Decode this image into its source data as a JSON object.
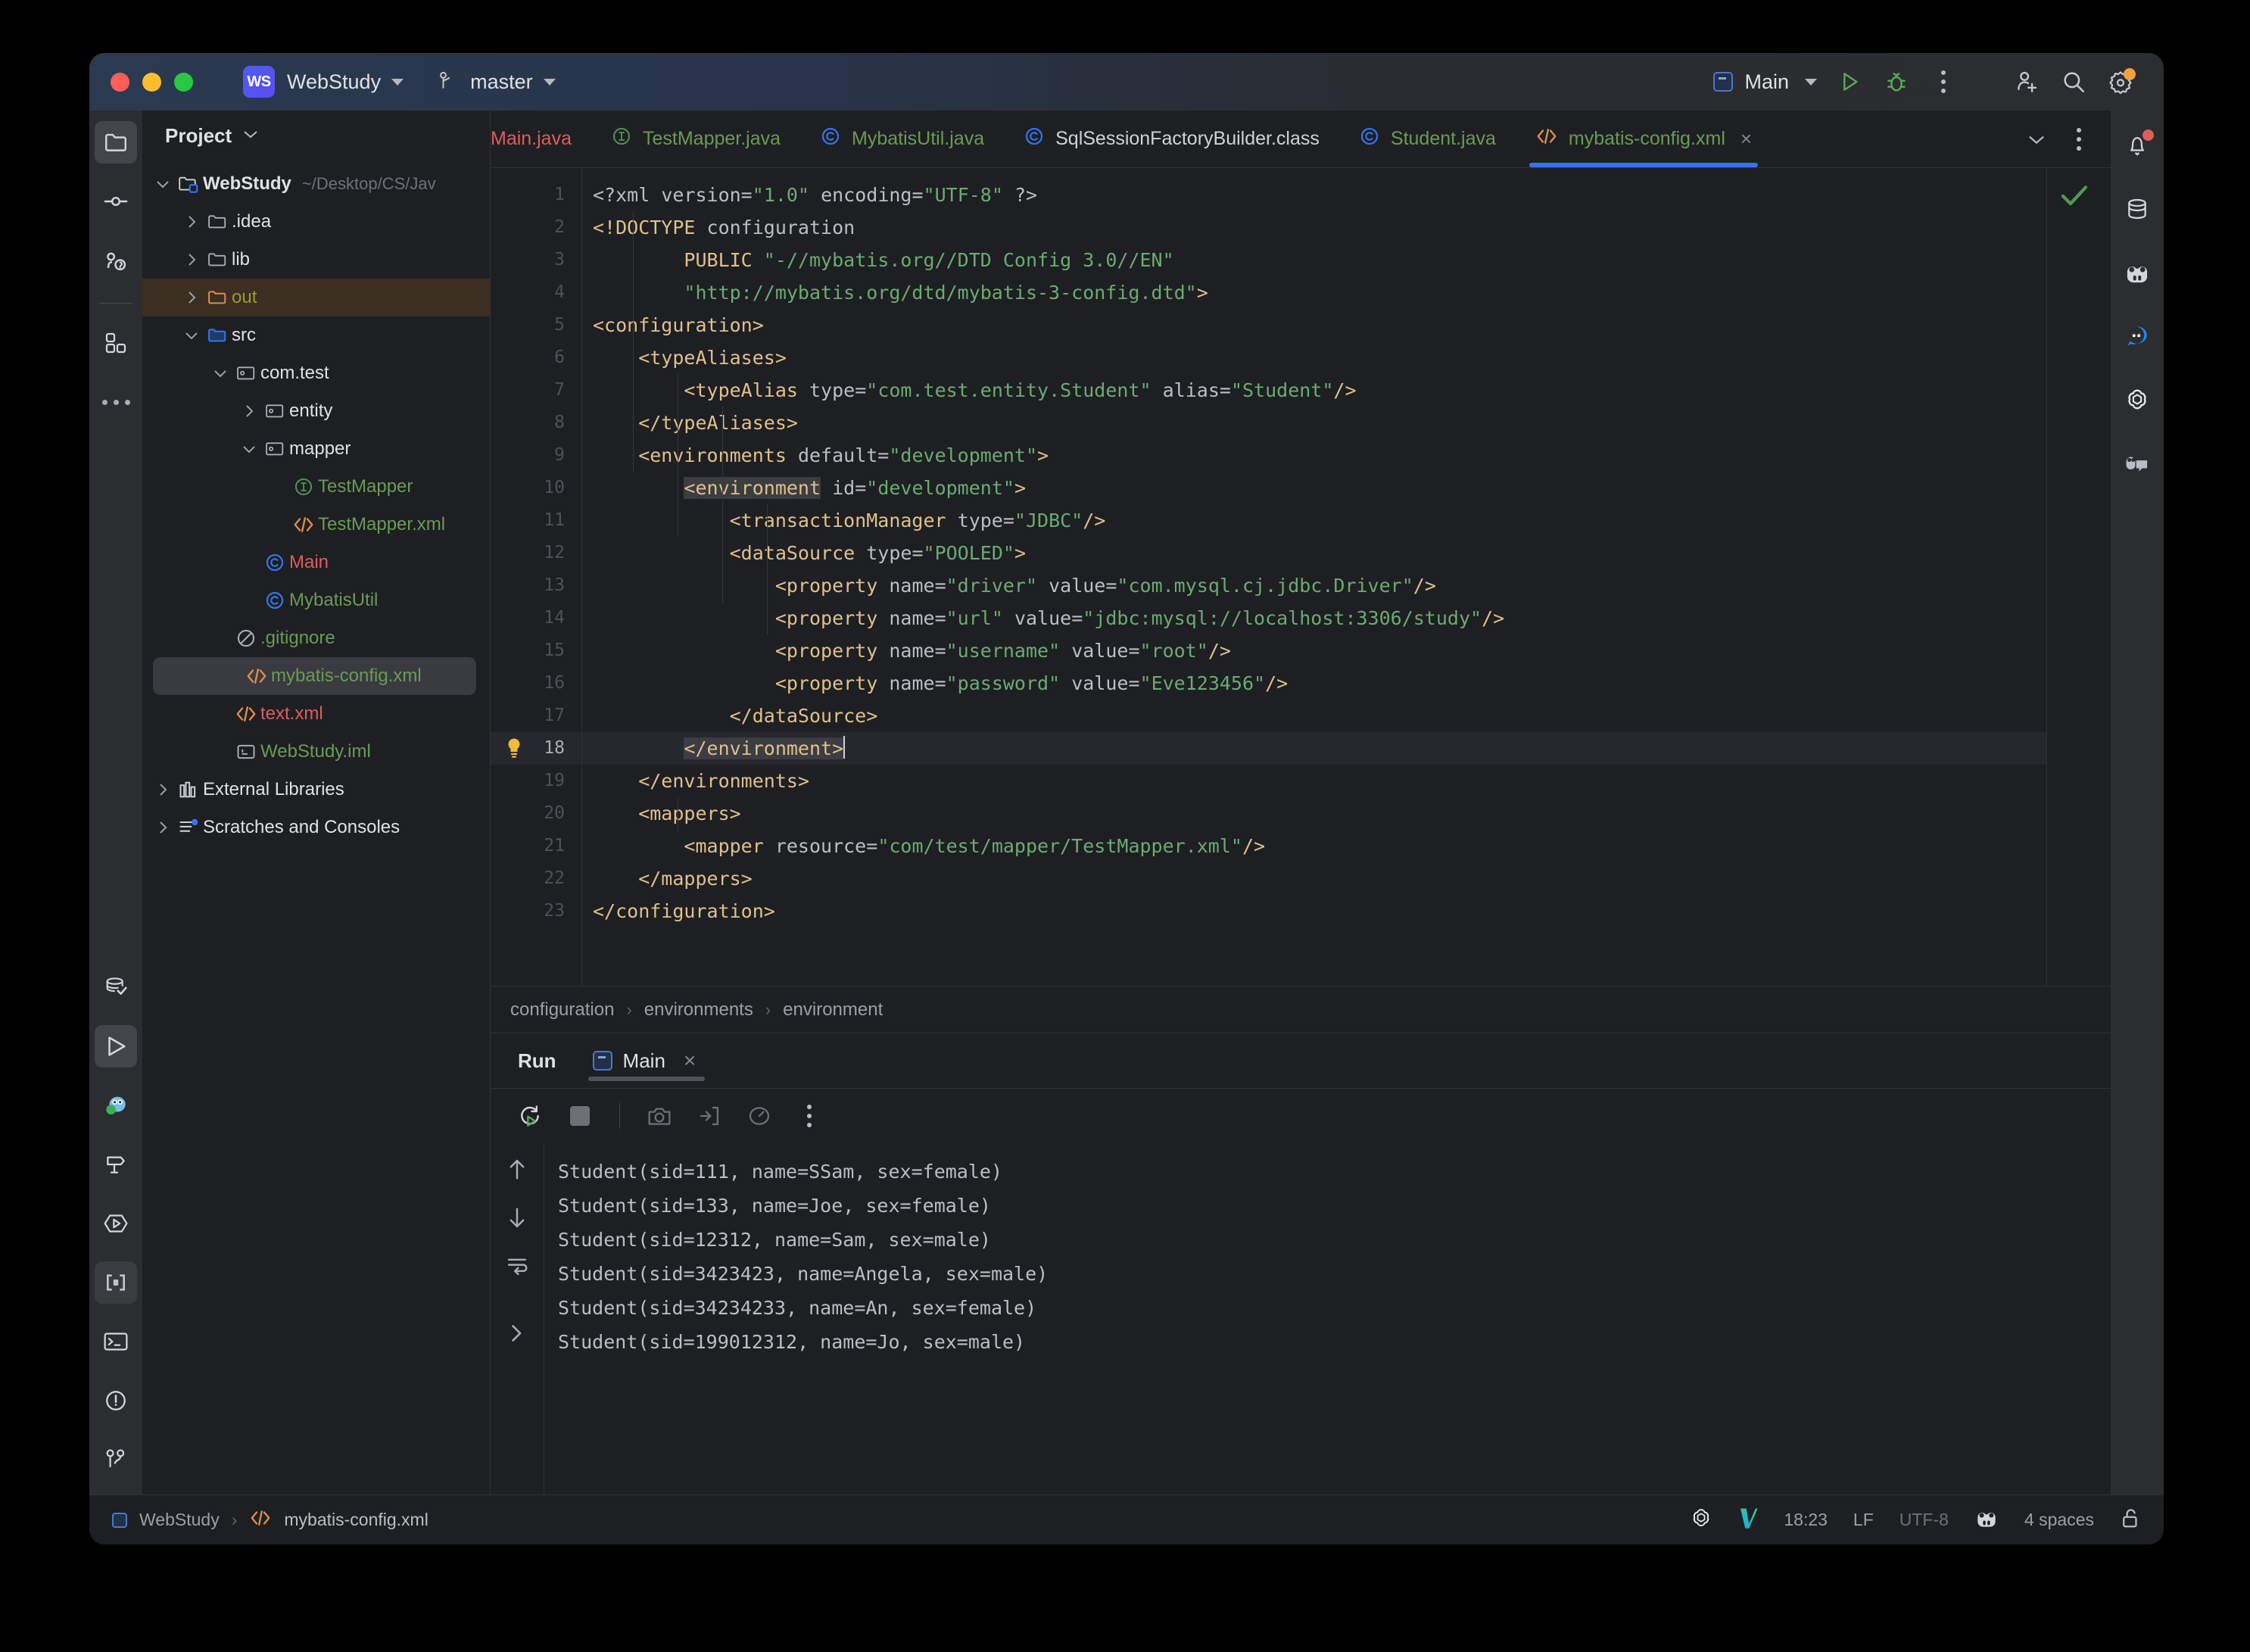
{
  "titlebar": {
    "project_badge": "WS",
    "project_name": "WebStudy",
    "branch": "master",
    "run_config": "Main",
    "icons": [
      "run-icon",
      "debug-icon",
      "more-actions-icon",
      "add-collaborator-icon",
      "search-everywhere-icon",
      "settings-icon"
    ]
  },
  "project_panel": {
    "title": "Project",
    "tree": [
      {
        "label": "WebStudy",
        "path": "~/Desktop/CS/Jav",
        "icon": "module-folder-icon",
        "arrow": "down",
        "indent": 0,
        "style": "bold",
        "state": "normal"
      },
      {
        "label": ".idea",
        "path": "",
        "icon": "folder-icon",
        "arrow": "right",
        "indent": 1,
        "style": "plain",
        "state": "normal"
      },
      {
        "label": "lib",
        "path": "",
        "icon": "folder-icon",
        "arrow": "right",
        "indent": 1,
        "style": "plain",
        "state": "normal"
      },
      {
        "label": "out",
        "path": "",
        "icon": "excluded-folder-icon",
        "arrow": "right",
        "indent": 1,
        "style": "olive",
        "state": "out"
      },
      {
        "label": "src",
        "path": "",
        "icon": "source-folder-icon",
        "arrow": "down",
        "indent": 1,
        "style": "plain",
        "state": "normal"
      },
      {
        "label": "com.test",
        "path": "",
        "icon": "package-icon",
        "arrow": "down",
        "indent": 2,
        "style": "plain",
        "state": "normal"
      },
      {
        "label": "entity",
        "path": "",
        "icon": "package-icon",
        "arrow": "right",
        "indent": 3,
        "style": "plain",
        "state": "normal"
      },
      {
        "label": "mapper",
        "path": "",
        "icon": "package-icon",
        "arrow": "down",
        "indent": 3,
        "style": "plain",
        "state": "normal"
      },
      {
        "label": "TestMapper",
        "path": "",
        "icon": "interface-icon",
        "arrow": "none",
        "indent": 4,
        "style": "green",
        "state": "normal"
      },
      {
        "label": "TestMapper.xml",
        "path": "",
        "icon": "xml-icon",
        "arrow": "none",
        "indent": 4,
        "style": "green",
        "state": "normal"
      },
      {
        "label": "Main",
        "path": "",
        "icon": "class-icon",
        "arrow": "none",
        "indent": 3,
        "style": "red",
        "state": "normal"
      },
      {
        "label": "MybatisUtil",
        "path": "",
        "icon": "class-icon",
        "arrow": "none",
        "indent": 3,
        "style": "green",
        "state": "normal"
      },
      {
        "label": ".gitignore",
        "path": "",
        "icon": "gitignore-icon",
        "arrow": "none",
        "indent": 2,
        "style": "green",
        "state": "normal"
      },
      {
        "label": "mybatis-config.xml",
        "path": "",
        "icon": "xml-icon",
        "arrow": "none",
        "indent": 2,
        "style": "green",
        "state": "selected"
      },
      {
        "label": "text.xml",
        "path": "",
        "icon": "xml-icon",
        "arrow": "none",
        "indent": 2,
        "style": "red",
        "state": "normal"
      },
      {
        "label": "WebStudy.iml",
        "path": "",
        "icon": "iml-icon",
        "arrow": "none",
        "indent": 2,
        "style": "green",
        "state": "normal"
      },
      {
        "label": "External Libraries",
        "path": "",
        "icon": "library-icon",
        "arrow": "right",
        "indent": 0,
        "style": "plain",
        "state": "normal"
      },
      {
        "label": "Scratches and Consoles",
        "path": "",
        "icon": "scratches-icon",
        "arrow": "right",
        "indent": 0,
        "style": "plain",
        "state": "normal"
      }
    ]
  },
  "editor": {
    "tabs": [
      {
        "label": "Main.java",
        "icon": "class-icon",
        "color": "red",
        "active": false,
        "clipped": true
      },
      {
        "label": "TestMapper.java",
        "icon": "interface-icon",
        "color": "green",
        "active": false,
        "clipped": false
      },
      {
        "label": "MybatisUtil.java",
        "icon": "class-icon",
        "color": "green",
        "active": false,
        "clipped": false
      },
      {
        "label": "SqlSessionFactoryBuilder.class",
        "icon": "class-icon",
        "color": "white",
        "active": false,
        "clipped": false
      },
      {
        "label": "Student.java",
        "icon": "class-icon",
        "color": "green",
        "active": false,
        "clipped": false
      },
      {
        "label": "mybatis-config.xml",
        "icon": "xml-icon",
        "color": "green",
        "active": true,
        "clipped": false
      }
    ],
    "tab_close": "×",
    "filename": "mybatis-config.xml",
    "inspection_status": "no-problems-check-icon",
    "current_line": 18,
    "line_count": 23,
    "lines": [
      {
        "n": 1,
        "segments": [
          [
            "plain",
            "<?xml "
          ],
          [
            "attr",
            "version"
          ],
          [
            "plain",
            "="
          ],
          [
            "str",
            "\"1.0\""
          ],
          [
            "plain",
            " "
          ],
          [
            "attr",
            "encoding"
          ],
          [
            "plain",
            "="
          ],
          [
            "str",
            "\"UTF-8\""
          ],
          [
            "plain",
            " ?>"
          ]
        ]
      },
      {
        "n": 2,
        "segments": [
          [
            "doct",
            "<!DOCTYPE"
          ],
          [
            "attr",
            " configuration"
          ]
        ]
      },
      {
        "n": 3,
        "segments": [
          [
            "doct",
            "        PUBLIC "
          ],
          [
            "str",
            "\"-//mybatis.org//DTD Config 3.0//EN\""
          ]
        ]
      },
      {
        "n": 4,
        "segments": [
          [
            "str",
            "        \"http://mybatis.org/dtd/mybatis-3-config.dtd\""
          ],
          [
            "doct",
            ">"
          ]
        ]
      },
      {
        "n": 5,
        "segments": [
          [
            "tag",
            "<configuration>"
          ]
        ]
      },
      {
        "n": 6,
        "segments": [
          [
            "tag",
            "    <typeAliases>"
          ]
        ]
      },
      {
        "n": 7,
        "segments": [
          [
            "tag",
            "        <typeAlias "
          ],
          [
            "attr",
            "type"
          ],
          [
            "plain",
            "="
          ],
          [
            "str",
            "\"com.test.entity.Student\""
          ],
          [
            "attr",
            " alias"
          ],
          [
            "plain",
            "="
          ],
          [
            "str",
            "\"Student\""
          ],
          [
            "tag",
            "/>"
          ]
        ]
      },
      {
        "n": 8,
        "segments": [
          [
            "tag",
            "    </typeAliases>"
          ]
        ]
      },
      {
        "n": 9,
        "segments": [
          [
            "tag",
            "    <environments "
          ],
          [
            "attr",
            "default"
          ],
          [
            "plain",
            "="
          ],
          [
            "str",
            "\"development\""
          ],
          [
            "tag",
            ">"
          ]
        ]
      },
      {
        "n": 10,
        "segments": [
          [
            "tag",
            "        "
          ],
          [
            "hlt",
            "<environment"
          ],
          [
            "attr",
            " id"
          ],
          [
            "plain",
            "="
          ],
          [
            "str",
            "\"development\""
          ],
          [
            "tag",
            ">"
          ]
        ]
      },
      {
        "n": 11,
        "segments": [
          [
            "tag",
            "            <transactionManager "
          ],
          [
            "attr",
            "type"
          ],
          [
            "plain",
            "="
          ],
          [
            "str",
            "\"JDBC\""
          ],
          [
            "tag",
            "/>"
          ]
        ]
      },
      {
        "n": 12,
        "segments": [
          [
            "tag",
            "            <dataSource "
          ],
          [
            "attr",
            "type"
          ],
          [
            "plain",
            "="
          ],
          [
            "str",
            "\"POOLED\""
          ],
          [
            "tag",
            ">"
          ]
        ]
      },
      {
        "n": 13,
        "segments": [
          [
            "tag",
            "                <property "
          ],
          [
            "attr",
            "name"
          ],
          [
            "plain",
            "="
          ],
          [
            "str",
            "\"driver\""
          ],
          [
            "attr",
            " value"
          ],
          [
            "plain",
            "="
          ],
          [
            "str",
            "\"com.mysql.cj.jdbc.Driver\""
          ],
          [
            "tag",
            "/>"
          ]
        ]
      },
      {
        "n": 14,
        "segments": [
          [
            "tag",
            "                <property "
          ],
          [
            "attr",
            "name"
          ],
          [
            "plain",
            "="
          ],
          [
            "str",
            "\"url\""
          ],
          [
            "attr",
            " value"
          ],
          [
            "plain",
            "="
          ],
          [
            "str",
            "\"jdbc:mysql://localhost:3306/study\""
          ],
          [
            "tag",
            "/>"
          ]
        ]
      },
      {
        "n": 15,
        "segments": [
          [
            "tag",
            "                <property "
          ],
          [
            "attr",
            "name"
          ],
          [
            "plain",
            "="
          ],
          [
            "str",
            "\"username\""
          ],
          [
            "attr",
            " value"
          ],
          [
            "plain",
            "="
          ],
          [
            "str",
            "\"root\""
          ],
          [
            "tag",
            "/>"
          ]
        ]
      },
      {
        "n": 16,
        "segments": [
          [
            "tag",
            "                <property "
          ],
          [
            "attr",
            "name"
          ],
          [
            "plain",
            "="
          ],
          [
            "str",
            "\"password\""
          ],
          [
            "attr",
            " value"
          ],
          [
            "plain",
            "="
          ],
          [
            "str",
            "\"Eve123456\""
          ],
          [
            "tag",
            "/>"
          ]
        ]
      },
      {
        "n": 17,
        "segments": [
          [
            "tag",
            "            </dataSource>"
          ]
        ]
      },
      {
        "n": 18,
        "segments": [
          [
            "tag",
            "        "
          ],
          [
            "hlt",
            "</environment>"
          ],
          [
            "caret",
            ""
          ]
        ]
      },
      {
        "n": 19,
        "segments": [
          [
            "tag",
            "    </environments>"
          ]
        ]
      },
      {
        "n": 20,
        "segments": [
          [
            "tag",
            "    <mappers>"
          ]
        ]
      },
      {
        "n": 21,
        "segments": [
          [
            "tag",
            "        <mapper "
          ],
          [
            "attr",
            "resource"
          ],
          [
            "plain",
            "="
          ],
          [
            "str",
            "\"com/test/mapper/TestMapper.xml\""
          ],
          [
            "tag",
            "/>"
          ]
        ]
      },
      {
        "n": 22,
        "segments": [
          [
            "tag",
            "    </mappers>"
          ]
        ]
      },
      {
        "n": 23,
        "segments": [
          [
            "tag",
            "</configuration>"
          ]
        ]
      }
    ],
    "breadcrumbs": [
      "configuration",
      "environments",
      "environment"
    ],
    "breadcrumb_separator": "›"
  },
  "run_window": {
    "title": "Run",
    "tab_label": "Main",
    "tab_close": "×",
    "toolbar_icons": [
      "rerun-icon",
      "stop-icon",
      "screenshot-icon",
      "export-icon",
      "profiler-icon",
      "more-icon"
    ],
    "side_icons": [
      "scroll-up-icon",
      "scroll-down-icon",
      "soft-wrap-icon",
      "expand-icon"
    ],
    "console_lines": [
      "Student(sid=111, name=SSam, sex=female)",
      "Student(sid=133, name=Joe, sex=female)",
      "Student(sid=12312, name=Sam, sex=male)",
      "Student(sid=3423423, name=Angela, sex=male)",
      "Student(sid=34234233, name=An, sex=female)",
      "Student(sid=199012312, name=Jo, sex=male)"
    ]
  },
  "statusbar": {
    "project": "WebStudy",
    "separator": "›",
    "file": "mybatis-config.xml",
    "time": "18:23",
    "line_separator": "LF",
    "encoding": "UTF-8",
    "indent": "4 spaces",
    "icons": [
      "openai-icon",
      "vim-icon",
      "database-mascot-icon",
      "lock-open-icon"
    ]
  },
  "right_rail": {
    "icons": [
      "notifications-icon",
      "database-icon",
      "mascot-icon",
      "ai-chat-icon",
      "openai-icon",
      "code-with-me-icon"
    ]
  },
  "left_rail": {
    "top_icons": [
      "project-icon",
      "commit-icon",
      "pull-requests-icon",
      "structure-icon",
      "more-tool-windows-icon"
    ],
    "bottom_icons": [
      "database-check-icon",
      "run-icon",
      "mybatis-icon",
      "build-icon",
      "services-icon",
      "terminal-brackets-icon",
      "terminal-icon",
      "problems-icon",
      "version-control-icon"
    ]
  },
  "colors": {
    "accent_blue": "#3574f0",
    "tag_orange": "#dfc08d",
    "string_green": "#6aab73",
    "tree_green": "#6a9b55",
    "tree_red": "#e05c5c",
    "panel_bg": "#1e1f22",
    "rail_bg": "#2b2d30"
  }
}
